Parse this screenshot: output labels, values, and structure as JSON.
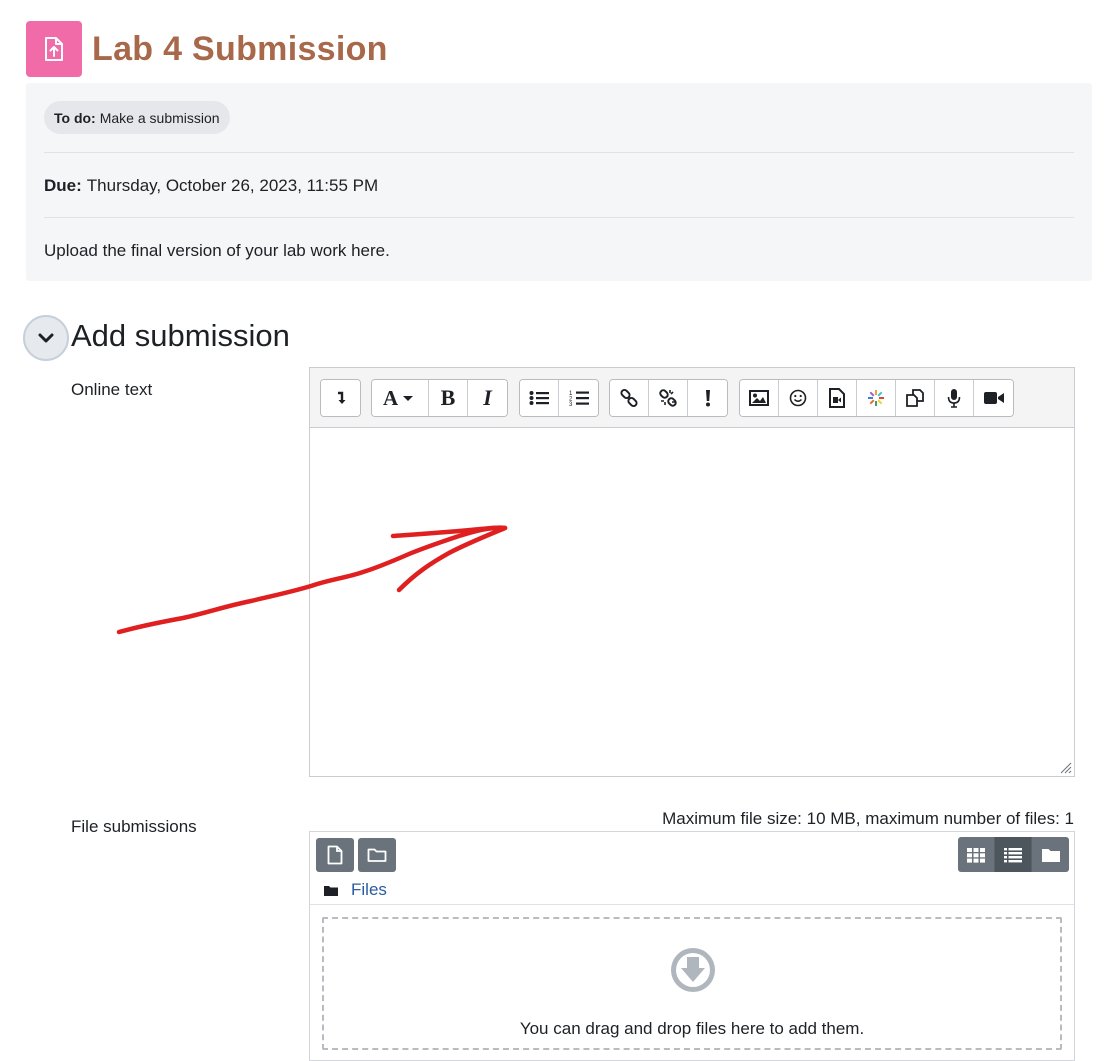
{
  "header": {
    "title": "Lab 4 Submission",
    "icon": "assignment-upload-icon",
    "icon_color": "#f06ba8",
    "title_color": "#a8684a"
  },
  "activity_info": {
    "todo_label": "To do:",
    "todo_text": "Make a submission",
    "due_label": "Due:",
    "due_date": "Thursday, October 26, 2023, 11:55 PM",
    "description": "Upload the final version of your lab work here."
  },
  "submission": {
    "section_title": "Add submission",
    "online_text_label": "Online text",
    "toolbar": [
      [
        "show-more-buttons"
      ],
      [
        "font-style",
        "bold",
        "italic"
      ],
      [
        "unordered-list",
        "ordered-list"
      ],
      [
        "link",
        "unlink",
        "equation"
      ],
      [
        "image",
        "emoji",
        "media",
        "h5p",
        "copy",
        "record-audio",
        "record-video"
      ]
    ],
    "annotation": "red-arrow-drawing",
    "annotation_color": "#e02020",
    "file_label": "File submissions",
    "file_limits": "Maximum file size: 10 MB, maximum number of files: 1",
    "folder_name": "Files",
    "dropzone_text": "You can drag and drop files here to add them.",
    "link_color": "#2a5c9e"
  }
}
